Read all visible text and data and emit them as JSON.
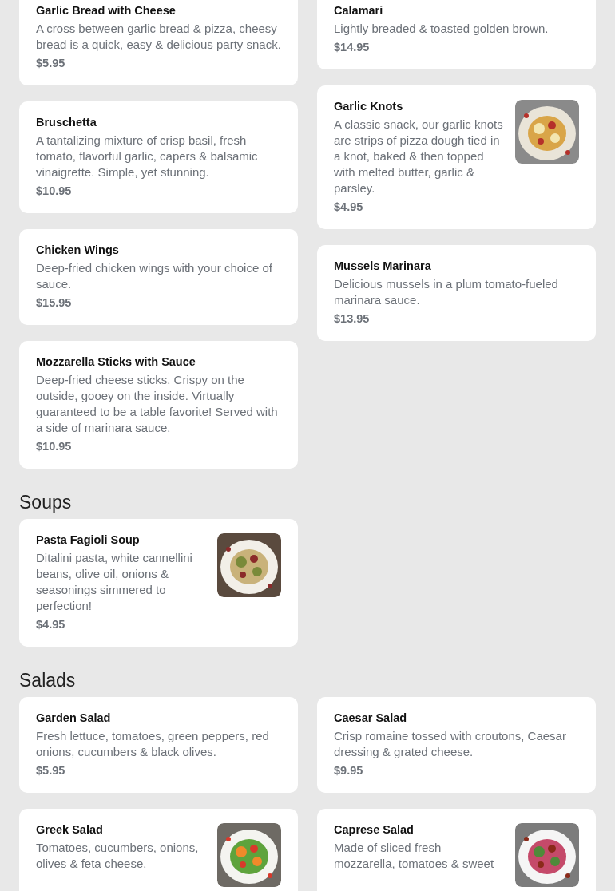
{
  "sections": [
    {
      "columns": [
        [
          {
            "name": "Garlic Bread with Cheese",
            "description": "A cross between garlic bread & pizza, cheesy bread is a quick, easy & delicious party snack.",
            "price": "$5.95"
          },
          {
            "name": "Bruschetta",
            "description": "A tantalizing mixture of crisp basil, fresh tomato, flavorful garlic, capers & balsamic vinaigrette. Simple, yet stunning.",
            "price": "$10.95"
          },
          {
            "name": "Chicken Wings",
            "description": "Deep-fried chicken wings with your choice of sauce.",
            "price": "$15.95"
          },
          {
            "name": "Mozzarella Sticks with Sauce",
            "description": "Deep-fried cheese sticks. Crispy on the outside, gooey on the inside. Virtually guaranteed to be a table favorite! Served with a side of marinara sauce.",
            "price": "$10.95"
          }
        ],
        [
          {
            "name": "Calamari",
            "description": "Lightly breaded & toasted golden brown.",
            "price": "$14.95"
          },
          {
            "name": "Garlic Knots",
            "description": "A classic snack, our garlic knots are strips of pizza dough tied in a knot, baked & then topped with melted butter, garlic & parsley.",
            "price": "$4.95"
          },
          {
            "name": "Mussels Marinara",
            "description": "Delicious mussels in a plum tomato-fueled marinara sauce.",
            "price": "$13.95"
          }
        ]
      ]
    },
    {
      "title": "Soups",
      "columns": [
        [
          {
            "name": "Pasta Fagioli Soup",
            "description": "Ditalini pasta, white cannellini beans, olive oil, onions & seasonings simmered to perfection!",
            "price": "$4.95"
          }
        ],
        []
      ]
    },
    {
      "title": "Salads",
      "columns": [
        [
          {
            "name": "Garden Salad",
            "description": "Fresh lettuce, tomatoes, green peppers, red onions, cucumbers & black olives.",
            "price": "$5.95"
          },
          {
            "name": "Greek Salad",
            "description": "Tomatoes, cucumbers, onions, olives & feta cheese."
          }
        ],
        [
          {
            "name": "Caesar Salad",
            "description": "Crisp romaine tossed with croutons, Caesar dressing & grated cheese.",
            "price": "$9.95"
          },
          {
            "name": "Caprese Salad",
            "description": "Made of sliced fresh mozzarella, tomatoes & sweet"
          }
        ]
      ]
    }
  ]
}
